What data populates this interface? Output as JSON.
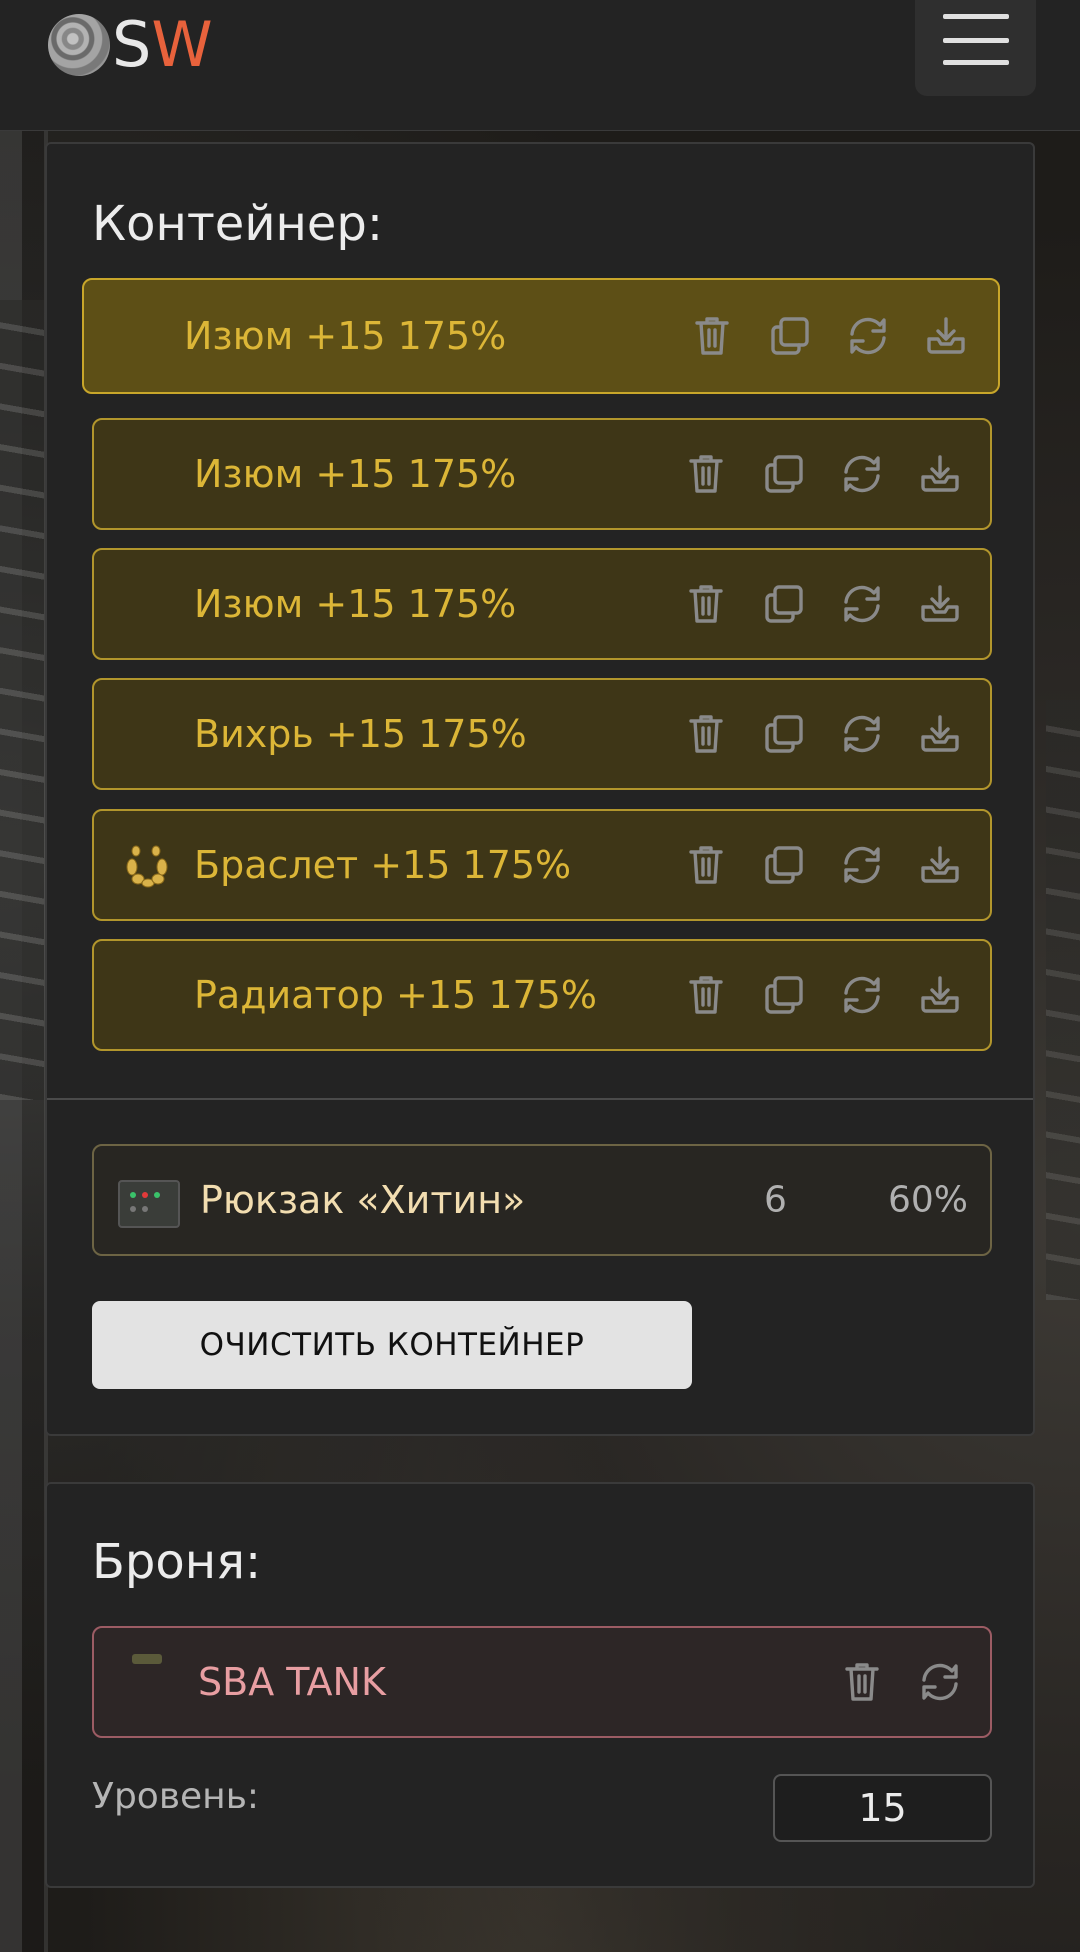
{
  "header": {
    "logo_text_s": "S",
    "logo_text_w": "W",
    "menu_icon": "hamburger-icon"
  },
  "container": {
    "title": "Контейнер:",
    "items": [
      {
        "label": "Изюм +15 175%",
        "active": true,
        "icon": ""
      },
      {
        "label": "Изюм +15 175%",
        "active": false,
        "icon": ""
      },
      {
        "label": "Изюм +15 175%",
        "active": false,
        "icon": ""
      },
      {
        "label": "Вихрь +15 175%",
        "active": false,
        "icon": ""
      },
      {
        "label": "Браслет +15 175%",
        "active": false,
        "icon": "bracelet-artifact-icon"
      },
      {
        "label": "Радиатор +15 175%",
        "active": false,
        "icon": ""
      }
    ],
    "item_actions": [
      "trash-icon",
      "copy-icon",
      "refresh-icon",
      "download-icon"
    ],
    "backpack": {
      "name": "Рюкзак «Хитин»",
      "count": "6",
      "percent": "60%",
      "icon": "backpack-icon"
    },
    "clear_button": "ОЧИСТИТЬ КОНТЕЙНЕР"
  },
  "armor": {
    "title": "Броня:",
    "item": {
      "label": "SBA TANK",
      "icon": "armor-icon"
    },
    "item_actions": [
      "trash-icon",
      "refresh-icon"
    ],
    "level_label": "Уровень:",
    "level_value": "15"
  },
  "colors": {
    "accent_gold": "#dcb637",
    "armor_pink": "#e89ea2",
    "logo_orange": "#e8623c"
  }
}
